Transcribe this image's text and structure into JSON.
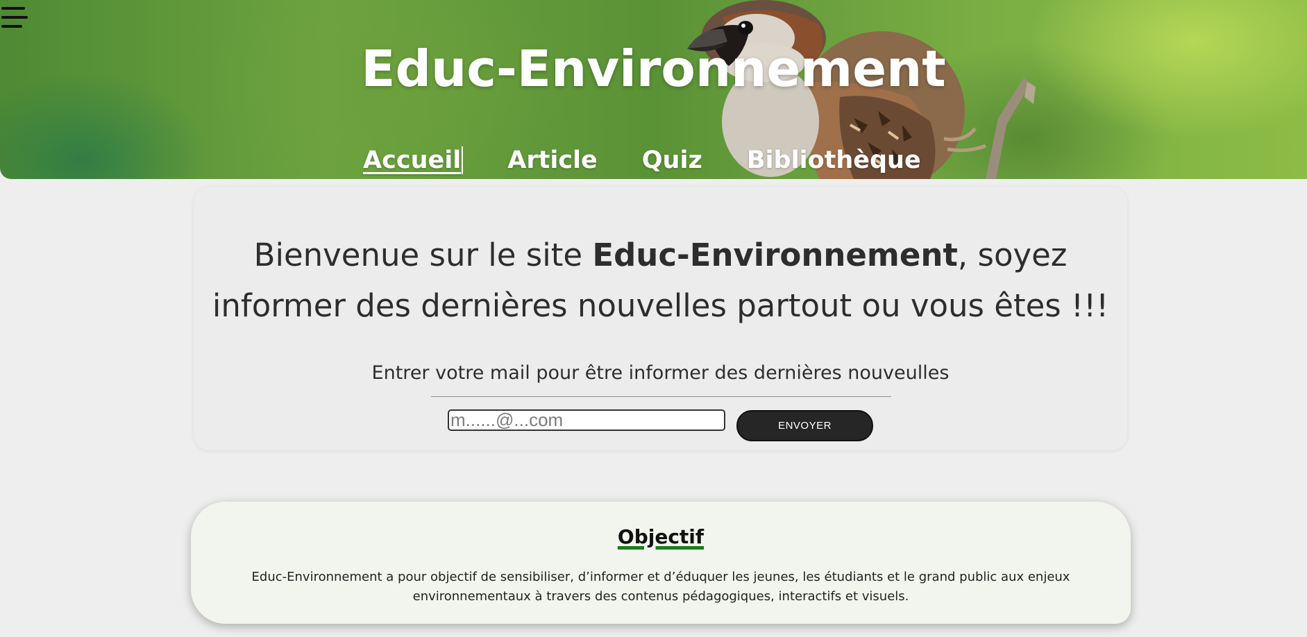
{
  "header": {
    "site_title": "Educ-Environnement",
    "nav": [
      {
        "label": "Accueil",
        "active": true
      },
      {
        "label": "Article",
        "active": false
      },
      {
        "label": "Quiz",
        "active": false
      },
      {
        "label": "Bibliothèque",
        "active": false
      }
    ],
    "menu_icon": "hamburger-menu-icon"
  },
  "welcome": {
    "line_prefix": "Bienvenue sur le site ",
    "brand": "Educ-Environnement",
    "line_suffix": ", soyez informer des dernières nouvelles partout ou vous êtes !!!",
    "newsletter_label": "Entrer votre mail pour être informer des dernières nouveulles",
    "email_placeholder": "m......@...com",
    "send_label": "ENVOYER"
  },
  "objectif": {
    "title": "Objectif",
    "text": "Educ-Environnement a pour objectif de sensibiliser, d’informer et d’éduquer les jeunes, les étudiants et le grand public aux enjeux environnementaux à travers des contenus pédagogiques, interactifs et visuels."
  },
  "colors": {
    "page_background": "#eeeeee",
    "button_background": "#262626",
    "objectif_underline": "#1b7d1b",
    "objectif_background": "#f2f4ee"
  }
}
